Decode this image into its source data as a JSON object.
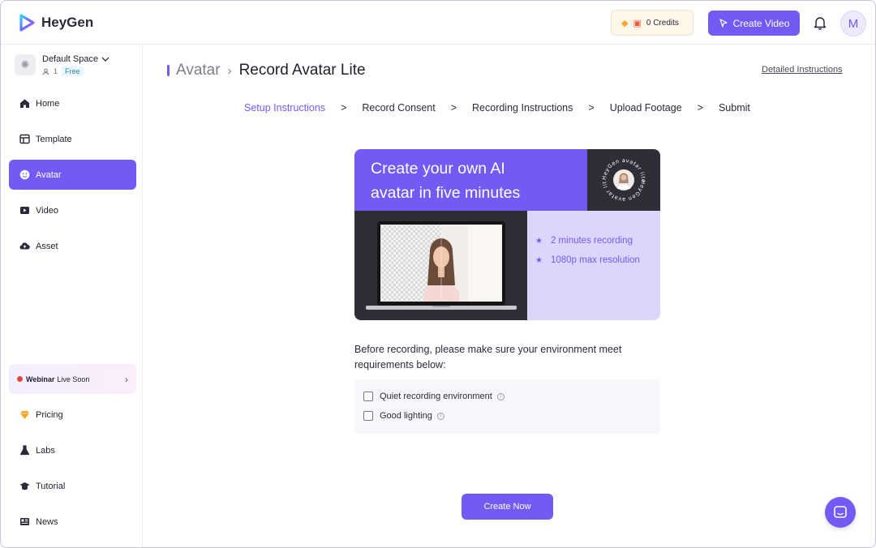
{
  "app": {
    "name": "HeyGen",
    "brand_color": "#7559f5"
  },
  "topbar": {
    "credits_label": "0 Credits",
    "create_video_label": "Create Video",
    "user_initial": "M"
  },
  "sidebar": {
    "space_name": "Default Space",
    "member_count": "1",
    "plan_badge": "Free",
    "items": [
      {
        "label": "Home",
        "icon": "home-icon"
      },
      {
        "label": "Template",
        "icon": "template-icon"
      },
      {
        "label": "Avatar",
        "icon": "avatar-icon",
        "active": true
      },
      {
        "label": "Video",
        "icon": "video-icon"
      },
      {
        "label": "Asset",
        "icon": "cloud-upload-icon"
      }
    ],
    "webinar": {
      "title": "Webinar",
      "status": "Live Soon"
    },
    "bottom_items": [
      {
        "label": "Pricing",
        "icon": "gem-icon"
      },
      {
        "label": "Labs",
        "icon": "flask-icon"
      },
      {
        "label": "Tutorial",
        "icon": "graduation-cap-icon"
      },
      {
        "label": "News",
        "icon": "newspaper-icon"
      }
    ]
  },
  "main": {
    "breadcrumb_parent": "Avatar",
    "breadcrumb_current": "Record Avatar Lite",
    "detailed_instructions": "Detailed Instructions",
    "steps": [
      {
        "label": "Setup Instructions",
        "active": true
      },
      {
        "label": "Record Consent"
      },
      {
        "label": "Recording Instructions"
      },
      {
        "label": "Upload Footage"
      },
      {
        "label": "Submit"
      }
    ],
    "step_separator": ">",
    "banner": {
      "title_line1": "Create your own AI",
      "title_line2": "avatar in five minutes",
      "badge_text": "HeyGen avatar lite",
      "features": [
        "2 minutes recording",
        "1080p max resolution"
      ]
    },
    "requirements_intro": "Before recording, please make sure your environment meet requirements below:",
    "requirements": [
      "Quiet recording environment",
      "Good lighting"
    ],
    "create_now_label": "Create Now"
  }
}
